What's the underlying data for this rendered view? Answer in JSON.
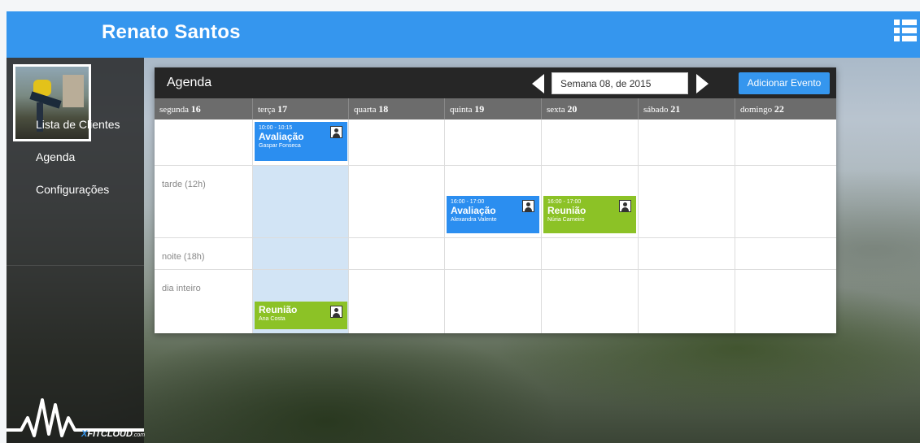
{
  "user": {
    "name": "Renato Santos"
  },
  "sidebar": {
    "items": [
      {
        "label": "Lista de Clientes"
      },
      {
        "label": "Agenda"
      },
      {
        "label": "Configurações"
      }
    ],
    "logo": {
      "x": "X",
      "brand": "FITCLOUD",
      "suffix": ".com"
    }
  },
  "agenda": {
    "title": "Agenda",
    "week_value": "Semana 08, de 2015",
    "add_button": "Adicionar Evento",
    "days": [
      {
        "name": "segunda",
        "num": "16"
      },
      {
        "name": "terça",
        "num": "17"
      },
      {
        "name": "quarta",
        "num": "18"
      },
      {
        "name": "quinta",
        "num": "19"
      },
      {
        "name": "sexta",
        "num": "20"
      },
      {
        "name": "sábado",
        "num": "21"
      },
      {
        "name": "domingo",
        "num": "22"
      }
    ],
    "rows": [
      {
        "label": ""
      },
      {
        "label": "tarde (12h)"
      },
      {
        "label": "noite (18h)"
      },
      {
        "label": "dia inteiro"
      }
    ],
    "events": [
      {
        "time": "10:00 - 10:15",
        "name": "Avaliação",
        "client": "Gaspar Fonseca",
        "color": "#2b8ef0"
      },
      {
        "time": "16:00 - 17:00",
        "name": "Avaliação",
        "client": "Alexandra Valente",
        "color": "#2b8ef0"
      },
      {
        "time": "16:00 - 17:00",
        "name": "Reunião",
        "client": "Núria Carneiro",
        "color": "#8cc226"
      },
      {
        "time": "",
        "name": "Reunião",
        "client": "Ana Costa",
        "color": "#8cc226"
      }
    ]
  },
  "colors": {
    "accent": "#3596ee",
    "event_blue": "#2b8ef0",
    "event_green": "#8cc226",
    "header_dark": "#262626",
    "day_header": "#6c6c6c"
  }
}
